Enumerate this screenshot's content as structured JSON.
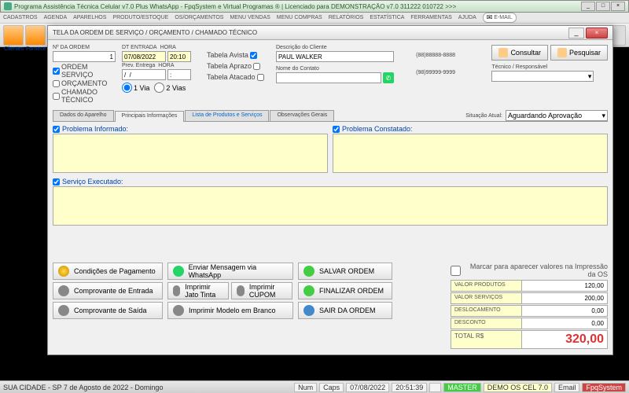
{
  "titlebar": "Programa Assistência Técnica Celular v7.0 Plus WhatsApp - FpqSystem e Virtual Programas ® | Licenciado para  DEMONSTRAÇÃO v7.0 311222 010722 >>>",
  "menu": [
    "CADASTROS",
    "AGENDA",
    "APARELHOS",
    "PRODUTO/ESTOQUE",
    "OS/ORÇAMENTOS",
    "MENU VENDAS",
    "MENU COMPRAS",
    "RELATÓRIOS",
    "ESTATÍSTICA",
    "FERRAMENTAS",
    "AJUDA"
  ],
  "email_label": "E-MAIL",
  "tb_labels": {
    "clientes": "Clientes",
    "fornece": "Fornece"
  },
  "dialog_title": "TELA DA ORDEM DE SERVIÇO / ORÇAMENTO / CHAMADO TÉCNICO",
  "order": {
    "num_label": "Nº DA ORDEM",
    "num": "1",
    "chk_os": "ORDEM SERVIÇO",
    "chk_orc": "ORÇAMENTO",
    "chk_ct": "CHAMADO TÉCNICO",
    "dt_label": "DT ENTRADA",
    "dt": "07/08/2022",
    "hora_label": "HORA",
    "hora": "20:10",
    "prev_label": "Prev. Entrega",
    "prev": "/  /",
    "prev_hora": ":",
    "via1": "1 Via",
    "via2": "2 Vias",
    "tabela_avista": "Tabela Avista",
    "tabela_aprazo": "Tabela Aprazo",
    "tabela_atacado": "Tabela Atacado"
  },
  "cliente": {
    "desc_label": "Descrição do Cliente",
    "desc": "PAUL WALKER",
    "contato_label": "Nome do Contato",
    "contato": "",
    "fone1": "(88)88888-8888",
    "fone2": "(98)99999-9999",
    "tecnico_label": "Técnico / Responsável"
  },
  "btns": {
    "consultar": "Consultar",
    "pesquisar": "Pesquisar"
  },
  "tabs": [
    "Dados do Aparelho",
    "Principais Informações",
    "Lista de Produtos e Serviços",
    "Observações Gerais"
  ],
  "situacao": {
    "label": "Situação Atual:",
    "value": "Aguardando Aprovação"
  },
  "sections": {
    "prob_inf": "Problema Informado:",
    "prob_const": "Problema Constatado:",
    "serv_exec": "Serviço Executado:"
  },
  "actions": {
    "cond_pag": "Condições de Pagamento",
    "whatsapp": "Enviar Mensagem via WhatsApp",
    "salvar": "SALVAR ORDEM",
    "comp_ent": "Comprovante de Entrada",
    "jato": "Imprimir Jato Tinta",
    "cupom": "Imprimir CUPOM",
    "finalizar": "FINALIZAR ORDEM",
    "comp_saida": "Comprovante de Saída",
    "branco": "Imprimir Modelo em Branco",
    "sair": "SAIR DA ORDEM"
  },
  "marker": "Marcar para aparecer valores na Impressão da OS",
  "totals": {
    "prod_label": "VALOR PRODUTOS",
    "prod": "120,00",
    "serv_label": "VALOR SERVIÇOS",
    "serv": "200,00",
    "desl_label": "DESLOCAMENTO",
    "desl": "0,00",
    "desc_label": "DESCONTO",
    "desc": "0,00",
    "total_label": "TOTAL R$",
    "total": "320,00"
  },
  "status": {
    "city": "SUA CIDADE - SP  7 de Agosto de 2022 - Domingo",
    "num": "Num",
    "caps": "Caps",
    "date": "07/08/2022",
    "time": "20:51:39",
    "master": "MASTER",
    "demo": "DEMO OS CEL 7.0",
    "email": "Email",
    "fpq": "FpqSystem"
  }
}
